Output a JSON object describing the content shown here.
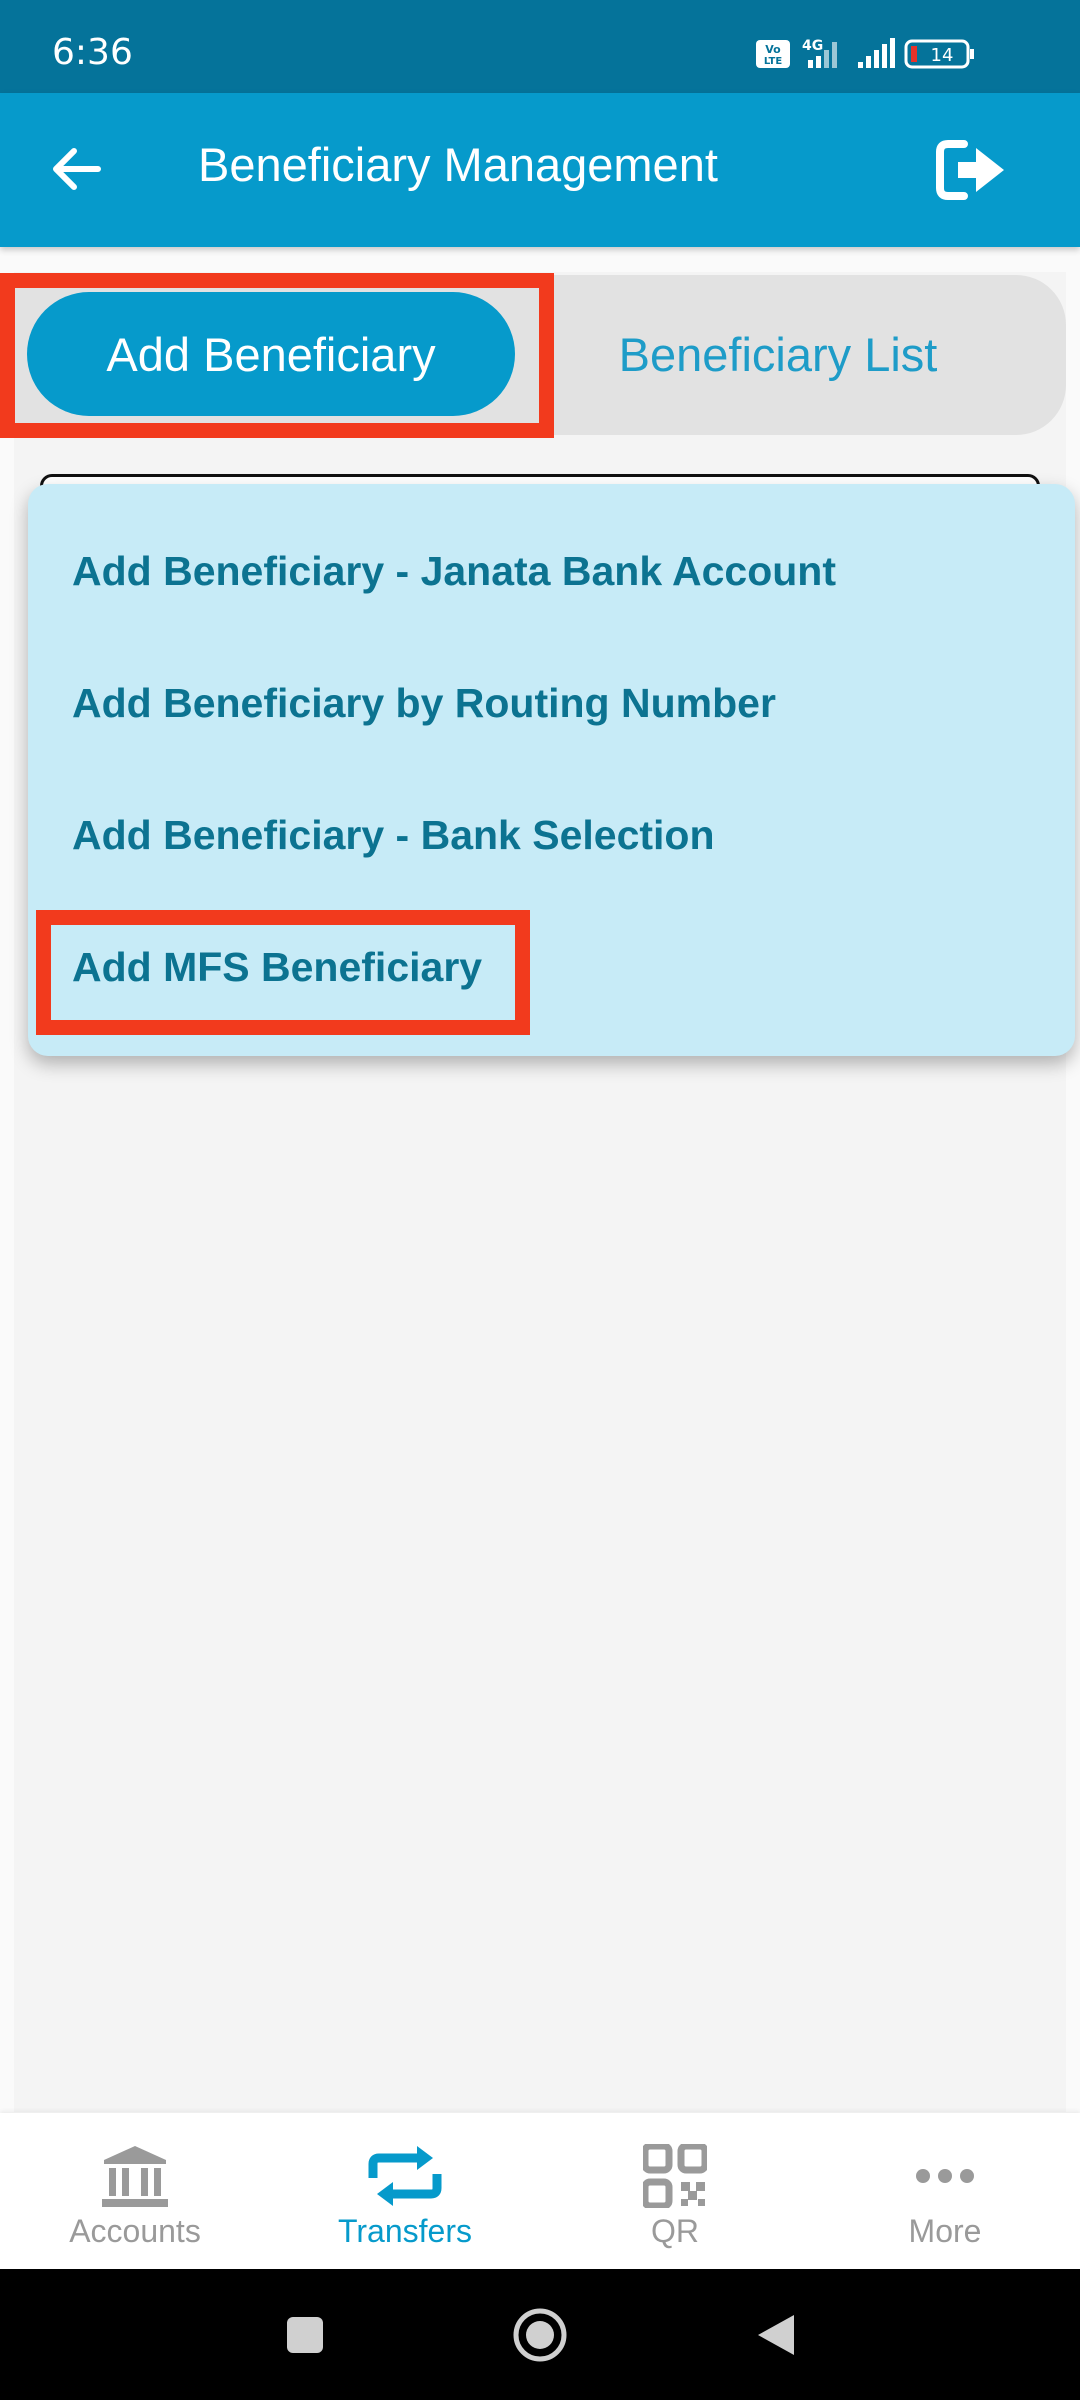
{
  "status_bar": {
    "time": "6:36",
    "network": "4G",
    "volte": "Vo LTE",
    "battery": "14"
  },
  "app_bar": {
    "title": "Beneficiary Management"
  },
  "tabs": {
    "add_label": "Add Beneficiary",
    "list_label": "Beneficiary List",
    "selected": "Add Beneficiary"
  },
  "dropdown": {
    "items": [
      "Add Beneficiary - Janata Bank Account",
      "Add Beneficiary by Routing Number",
      "Add Beneficiary - Bank Selection",
      "Add MFS Beneficiary"
    ]
  },
  "bottom_nav": {
    "items": [
      {
        "label": "Accounts",
        "icon": "bank-icon",
        "active": false
      },
      {
        "label": "Transfers",
        "icon": "transfer-icon",
        "active": true
      },
      {
        "label": "QR",
        "icon": "qr-icon",
        "active": false
      },
      {
        "label": "More",
        "icon": "more-icon",
        "active": false
      }
    ]
  },
  "colors": {
    "status_bar": "#05739a",
    "app_bar": "#069acb",
    "dropdown_bg": "#c7ebf7",
    "menu_text": "#0c7391",
    "highlight": "#f23a1d",
    "inactive": "#9a9a9a"
  }
}
